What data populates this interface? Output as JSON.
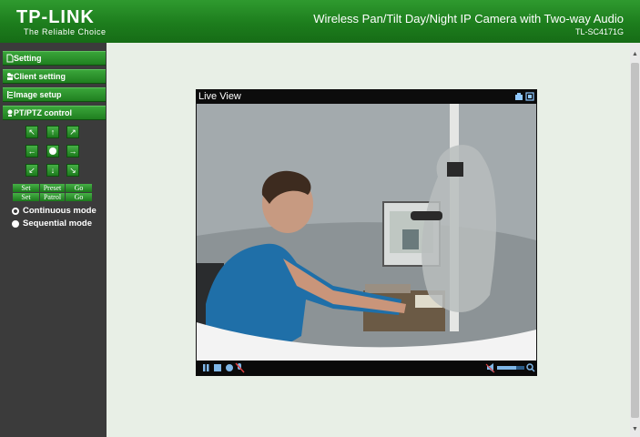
{
  "header": {
    "brand": "TP-LINK",
    "tagline": "The Reliable Choice",
    "title": "Wireless Pan/Tilt Day/Night IP Camera with Two-way Audio",
    "model": "TL-SC4171G"
  },
  "sidebar": {
    "menu": [
      {
        "label": "Setting",
        "icon": "document-icon"
      },
      {
        "label": "Client setting",
        "icon": "users-icon"
      },
      {
        "label": "Image setup",
        "icon": "image-setup-icon"
      },
      {
        "label": "PT/PTZ control",
        "icon": "ptz-icon"
      }
    ],
    "ptz": {
      "arrows": [
        "↖",
        "↑",
        "↗",
        "←",
        "→",
        "↙",
        "↓",
        "↘"
      ]
    },
    "commands": {
      "row1": [
        "Set",
        "Preset",
        "Go"
      ],
      "row2": [
        "Set",
        "Patrol",
        "Go"
      ]
    },
    "modes": [
      {
        "label": "Continuous mode",
        "selected": false
      },
      {
        "label": "Sequential mode",
        "selected": true
      }
    ]
  },
  "viewer": {
    "title": "Live View",
    "volume_level": 0.7
  },
  "colors": {
    "brand_green": "#1d7d1d",
    "sidebar_bg": "#3b3b3b",
    "content_bg": "#e8efe6"
  }
}
